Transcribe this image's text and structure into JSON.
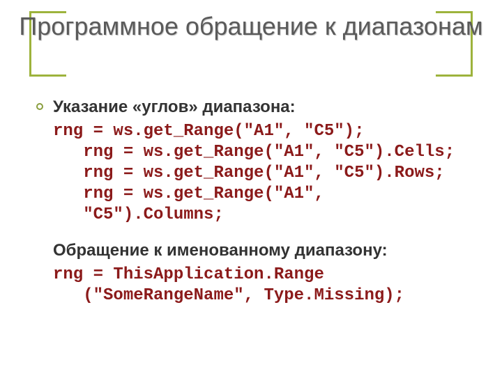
{
  "title": "Программное обращение к диапазонам",
  "section1": {
    "heading": "Указание «углов» диапазона:",
    "code": "rng = ws.get_Range(\"A1\", \"C5\");\n   rng = ws.get_Range(\"A1\", \"C5\").Cells;\n   rng = ws.get_Range(\"A1\", \"C5\").Rows;\n   rng = ws.get_Range(\"A1\",\n   \"C5\").Columns;"
  },
  "section2": {
    "heading": "Обращение к именованному диапазону:",
    "code": "rng = ThisApplication.Range\n   (\"SomeRangeName\", Type.Missing);"
  }
}
